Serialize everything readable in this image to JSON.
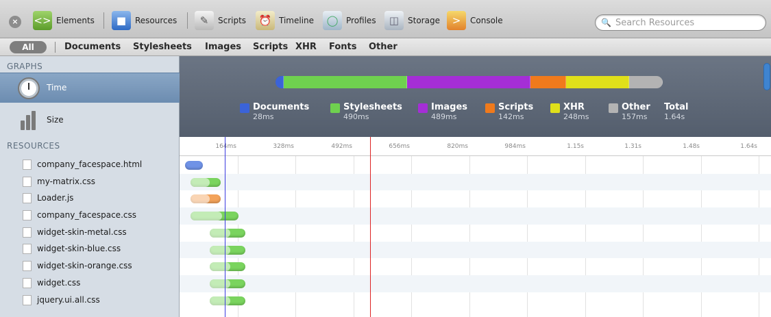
{
  "toolbar": {
    "close": "×",
    "buttons": [
      {
        "label": "Elements",
        "icon": "elements-icon"
      },
      {
        "label": "Resources",
        "icon": "resources-icon"
      },
      {
        "label": "Scripts",
        "icon": "scripts-icon"
      },
      {
        "label": "Timeline",
        "icon": "timeline-icon"
      },
      {
        "label": "Profiles",
        "icon": "profiles-icon"
      },
      {
        "label": "Storage",
        "icon": "storage-icon"
      },
      {
        "label": "Console",
        "icon": "console-icon"
      }
    ],
    "search_placeholder": "Search Resources"
  },
  "filters": {
    "all": "All",
    "items": [
      "Documents",
      "Stylesheets",
      "Images",
      "Scripts",
      "XHR",
      "Fonts",
      "Other"
    ]
  },
  "sidebar": {
    "graphs_heading": "GRAPHS",
    "time_label": "Time",
    "size_label": "Size",
    "resources_heading": "RESOURCES",
    "resources": [
      "company_facespace.html",
      "my-matrix.css",
      "Loader.js",
      "company_facespace.css",
      "widget-skin-metal.css",
      "widget-skin-blue.css",
      "widget-skin-orange.css",
      "widget.css",
      "jquery.ui.all.css"
    ]
  },
  "summary": {
    "segments": [
      {
        "name": "Documents",
        "value": "28ms",
        "color": "#3b63d8"
      },
      {
        "name": "Stylesheets",
        "value": "490ms",
        "color": "#6fd14f"
      },
      {
        "name": "Images",
        "value": "489ms",
        "color": "#a52ed6"
      },
      {
        "name": "Scripts",
        "value": "142ms",
        "color": "#f07a1c"
      },
      {
        "name": "XHR",
        "value": "248ms",
        "color": "#e0e01a"
      },
      {
        "name": "Other",
        "value": "157ms",
        "color": "#b3b3b3"
      }
    ],
    "total_label": "Total",
    "total_value": "1.64s"
  },
  "timeline": {
    "ticks": [
      "164ms",
      "328ms",
      "492ms",
      "656ms",
      "820ms",
      "984ms",
      "1.15s",
      "1.31s",
      "1.48s",
      "1.64s"
    ],
    "rows": [
      {
        "type": "document",
        "color": "#6f92e6"
      },
      {
        "type": "stylesheet",
        "color": "#7ad45e"
      },
      {
        "type": "script",
        "color": "#f3a35a"
      },
      {
        "type": "stylesheet",
        "color": "#7ad45e"
      },
      {
        "type": "stylesheet",
        "color": "#7ad45e"
      },
      {
        "type": "stylesheet",
        "color": "#7ad45e"
      },
      {
        "type": "stylesheet",
        "color": "#7ad45e"
      },
      {
        "type": "stylesheet",
        "color": "#7ad45e"
      },
      {
        "type": "stylesheet",
        "color": "#7ad45e"
      }
    ]
  }
}
